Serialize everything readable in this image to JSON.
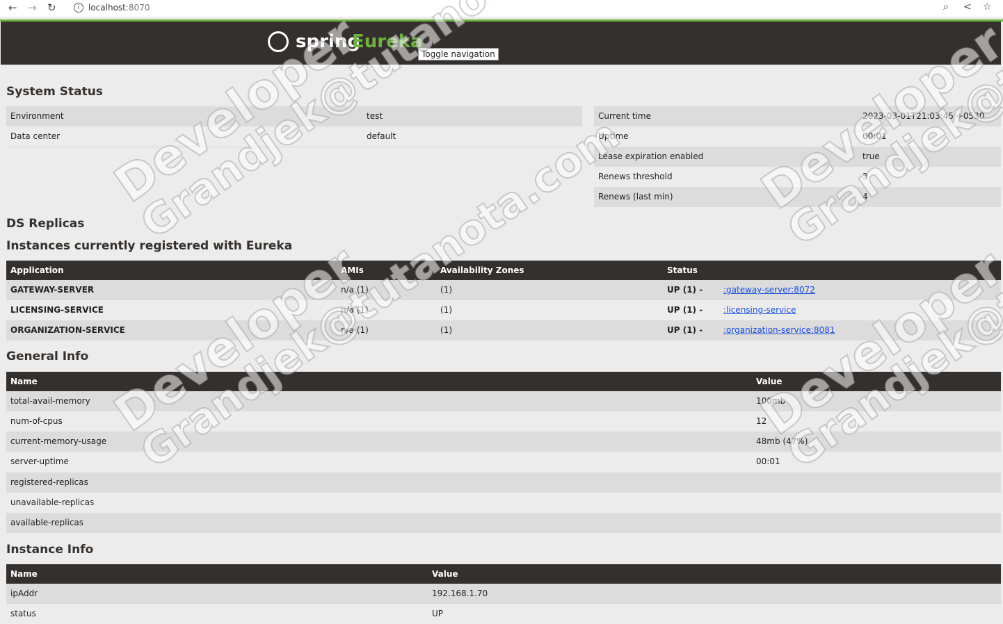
{
  "browser": {
    "url_host": "localhost",
    "url_port": ":8070"
  },
  "navbar": {
    "brand_spring": "spring",
    "brand_eureka": "Eureka",
    "toggle_label": "Toggle navigation"
  },
  "system_status": {
    "title": "System Status",
    "left": [
      {
        "label": "Environment",
        "value": "test"
      },
      {
        "label": "Data center",
        "value": "default"
      }
    ],
    "right": [
      {
        "label": "Current time",
        "value": "2023-03-01T21:03:45 +0530"
      },
      {
        "label": "Uptime",
        "value": "00:01"
      },
      {
        "label": "Lease expiration enabled",
        "value": "true"
      },
      {
        "label": "Renews threshold",
        "value": "3"
      },
      {
        "label": "Renews (last min)",
        "value": "4"
      }
    ]
  },
  "ds_replicas": {
    "title": "DS Replicas"
  },
  "instances": {
    "title": "Instances currently registered with Eureka",
    "headers": [
      "Application",
      "AMIs",
      "Availability Zones",
      "Status"
    ],
    "rows": [
      {
        "app": "GATEWAY-SERVER",
        "amis": "n/a (1)",
        "zones": "(1)",
        "status": "UP (1) -",
        "link": ":gateway-server:8072"
      },
      {
        "app": "LICENSING-SERVICE",
        "amis": "n/a (1)",
        "zones": "(1)",
        "status": "UP (1) -",
        "link": ":licensing-service"
      },
      {
        "app": "ORGANIZATION-SERVICE",
        "amis": "n/a (1)",
        "zones": "(1)",
        "status": "UP (1) -",
        "link": ":organization-service:8081"
      }
    ]
  },
  "general_info": {
    "title": "General Info",
    "headers": [
      "Name",
      "Value"
    ],
    "rows": [
      {
        "name": "total-avail-memory",
        "value": "100mb"
      },
      {
        "name": "num-of-cpus",
        "value": "12"
      },
      {
        "name": "current-memory-usage",
        "value": "48mb (47%)"
      },
      {
        "name": "server-uptime",
        "value": "00:01"
      },
      {
        "name": "registered-replicas",
        "value": ""
      },
      {
        "name": "unavailable-replicas",
        "value": ""
      },
      {
        "name": "available-replicas",
        "value": ""
      }
    ]
  },
  "instance_info": {
    "title": "Instance Info",
    "headers": [
      "Name",
      "Value"
    ],
    "rows": [
      {
        "name": "ipAddr",
        "value": "192.168.1.70"
      },
      {
        "name": "status",
        "value": "UP"
      }
    ]
  },
  "watermarks": [
    "Developer",
    "Grandjek@tutanota.com"
  ]
}
